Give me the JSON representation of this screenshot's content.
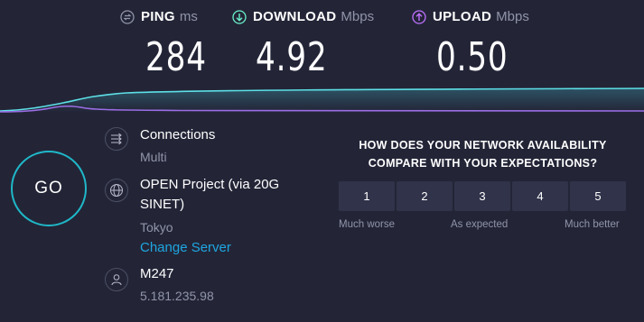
{
  "metrics": {
    "ping": {
      "label": "PING",
      "unit": "ms",
      "value": "284",
      "icon": "ping-icon",
      "color": "#9193a8"
    },
    "download": {
      "label": "DOWNLOAD",
      "unit": "Mbps",
      "value": "4.92",
      "icon": "download-arrow-icon",
      "color": "#6af0c8"
    },
    "upload": {
      "label": "UPLOAD",
      "unit": "Mbps",
      "value": "0.50",
      "icon": "upload-arrow-icon",
      "color": "#bf71ff"
    }
  },
  "graph": {
    "download_color": "#5de0e6",
    "upload_color": "#9b6ee6"
  },
  "go_button": {
    "label": "GO",
    "ring_color": "#1fb8c8"
  },
  "connections": {
    "icon": "connections-arrows-icon",
    "title": "Connections",
    "value": "Multi"
  },
  "server": {
    "icon": "globe-icon",
    "name_line1": "OPEN Project (via 20G",
    "name_line2": "SINET)",
    "location": "Tokyo",
    "change_label": "Change Server",
    "link_color": "#1fa6e0"
  },
  "provider": {
    "icon": "user-icon",
    "name": "M247",
    "ip": "5.181.235.98"
  },
  "survey": {
    "question_line1": "HOW DOES YOUR NETWORK AVAILABILITY",
    "question_line2": "COMPARE WITH YOUR EXPECTATIONS?",
    "options": [
      "1",
      "2",
      "3",
      "4",
      "5"
    ],
    "scale_low": "Much worse",
    "scale_mid": "As expected",
    "scale_high": "Much better"
  }
}
